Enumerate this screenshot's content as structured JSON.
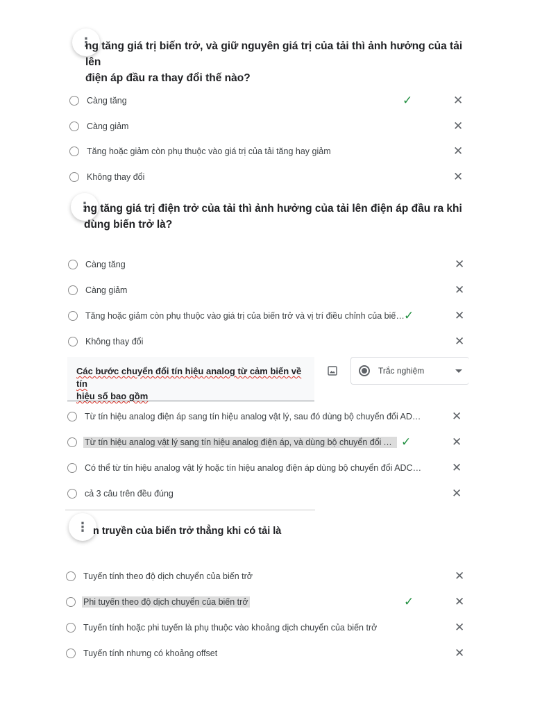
{
  "icons": {
    "menu": "more-vert-icon",
    "check": "check-icon",
    "close": "close-icon",
    "image": "image-icon",
    "radio": "radio-button-icon",
    "dropdown": "arrow-drop-down-icon"
  },
  "colors": {
    "check": "#1e8e3e",
    "highlight": "#dcdcdc",
    "spellcheck": "#d93025"
  },
  "questions": [
    {
      "title_line1": "ng tăng giá trị biến trở, và giữ nguyên giá trị của tải thì ảnh hưởng của tải lên",
      "title_line2": "điện áp đầu ra thay đổi thế nào?",
      "options": [
        {
          "label": "Càng tăng",
          "correct": true
        },
        {
          "label": "Càng giảm",
          "correct": false
        },
        {
          "label": "Tăng hoặc giảm còn phụ thuộc vào giá trị của tải tăng hay giảm",
          "correct": false
        },
        {
          "label": "Không thay đổi",
          "correct": false
        }
      ]
    },
    {
      "title_line1": "ng tăng giá trị điện trở của tải thì ảnh hưởng của tải lên điện áp đầu ra khi",
      "title_line2": "dùng biến trở là?",
      "options": [
        {
          "label": "Càng tăng",
          "correct": false
        },
        {
          "label": "Càng giảm",
          "correct": false
        },
        {
          "label": "Tăng hoặc giảm còn phụ thuộc vào giá trị của biến trở và vị trí điều chỉnh của biến trở",
          "correct": true
        },
        {
          "label": "Không thay đổi",
          "correct": false
        }
      ]
    },
    {
      "title_line1": "Các bước chuyển đổi tín hiệu analog từ cảm biến về tín",
      "title_line2": "hiệu số bao gồm",
      "type_select": "Trắc nghiệm",
      "options": [
        {
          "label": "Từ tín hiệu analog điện áp sang tín hiệu analog vật lý, sau đó dùng bộ chuyển đổi ADC chu...",
          "correct": false
        },
        {
          "label": "Từ tín hiệu analog vật lý sang tín hiệu analog điện áp, và dùng bộ chuyển đổi ADC chu",
          "correct": true
        },
        {
          "label": "Có thể từ tín hiệu analog vật lý hoặc tín hiệu analog điện áp dùng bộ chuyển đổi ADC chuy...",
          "correct": false
        },
        {
          "label": "cả 3 câu trên đều đúng",
          "correct": false
        }
      ]
    },
    {
      "title_line1": "n truyền của biến trở thẳng khi có tải là",
      "options": [
        {
          "label": "Tuyến tính theo độ dịch chuyển của biến trở",
          "correct": false
        },
        {
          "label": "Phi tuyến theo độ dịch chuyển của biến trở",
          "correct": true
        },
        {
          "label": "Tuyến tính hoặc phi tuyến là phụ thuộc vào khoảng dịch chuyển của biến trở",
          "correct": false
        },
        {
          "label": "Tuyến tính nhưng có khoảng offset",
          "correct": false
        }
      ]
    }
  ]
}
